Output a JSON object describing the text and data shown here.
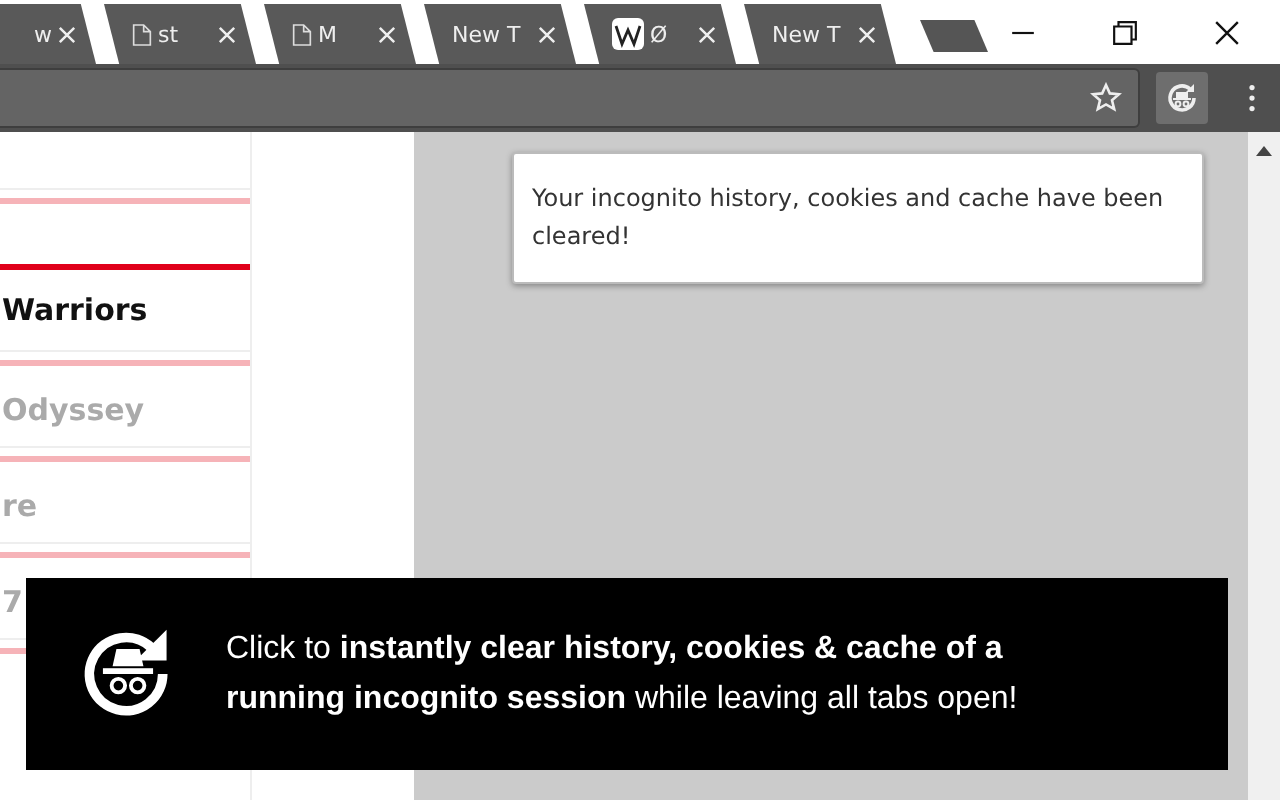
{
  "tabs": [
    {
      "title": "w",
      "kind": "plain"
    },
    {
      "title": "st",
      "kind": "page"
    },
    {
      "title": "M",
      "kind": "page"
    },
    {
      "title": "New T",
      "kind": "plain"
    },
    {
      "title": "Ø",
      "kind": "wiki"
    },
    {
      "title": "New T",
      "kind": "plain"
    }
  ],
  "page": {
    "items": [
      {
        "title": "Warriors",
        "faded": false
      },
      {
        "title": "Odyssey",
        "faded": true
      },
      {
        "title": "re",
        "faded": true
      },
      {
        "title": "7",
        "faded": true
      }
    ]
  },
  "popup": {
    "text": "Your incognito history, cookies and cache have been cleared!"
  },
  "banner": {
    "text": "Click to **instantly clear history, cookies & cache of a running incognito session** while leaving all tabs open!"
  }
}
